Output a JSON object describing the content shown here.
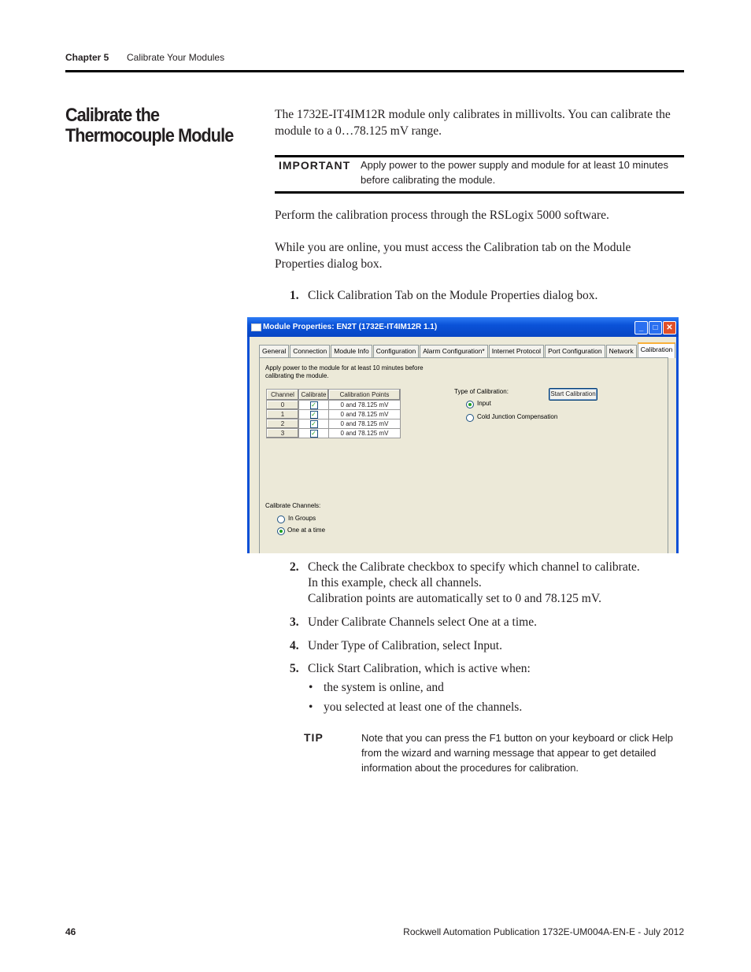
{
  "header": {
    "chapter": "Chapter 5",
    "title": "Calibrate Your Modules"
  },
  "section_title": "Calibrate the Thermocouple Module",
  "intro": "The 1732E-IT4IM12R module only calibrates in millivolts. You can calibrate the module to a 0…78.125 mV range.",
  "important": {
    "label": "IMPORTANT",
    "text": "Apply power to the power supply and module for at least 10 minutes before calibrating the module."
  },
  "para1": "Perform the calibration process through the RSLogix 5000 software.",
  "para2": "While you are online, you must access the Calibration tab on the Module Properties dialog box.",
  "steps": [
    {
      "num": "1.",
      "text": "Click Calibration Tab on the Module Properties dialog box."
    },
    {
      "num": "2.",
      "text": "Check the Calibrate checkbox to specify which channel to calibrate.",
      "extra1": "In this example, check all channels.",
      "extra2": "Calibration points are automatically set to 0 and 78.125 mV."
    },
    {
      "num": "3.",
      "text": "Under Calibrate Channels select One at a time."
    },
    {
      "num": "4.",
      "text": "Under Type of Calibration, select Input."
    },
    {
      "num": "5.",
      "text": "Click Start Calibration, which is active when:"
    }
  ],
  "bullets": [
    "the system is online, and",
    "you selected at least one of the channels."
  ],
  "tip": {
    "label": "TIP",
    "text": "Note that you can press the F1 button on your keyboard or click Help from the wizard and warning message that appear to get detailed information about the procedures for calibration."
  },
  "dialog": {
    "title": "Module Properties: EN2T (1732E-IT4IM12R 1.1)",
    "tabs": [
      "General",
      "Connection",
      "Module Info",
      "Configuration",
      "Alarm Configuration*",
      "Internet Protocol",
      "Port Configuration",
      "Network",
      "Calibration"
    ],
    "active_tab": "Calibration",
    "notice": "Apply power to the module for at least 10 minutes before calibrating the module.",
    "table": {
      "headers": [
        "Channel",
        "Calibrate",
        "Calibration Points"
      ],
      "rows": [
        {
          "channel": "0",
          "checked": true,
          "points": "0 and 78.125 mV"
        },
        {
          "channel": "1",
          "checked": true,
          "points": "0 and 78.125 mV"
        },
        {
          "channel": "2",
          "checked": true,
          "points": "0 and 78.125 mV"
        },
        {
          "channel": "3",
          "checked": true,
          "points": "0 and 78.125 mV"
        }
      ]
    },
    "type_label": "Type of Calibration:",
    "type_options": [
      "Input",
      "Cold Junction Compensation"
    ],
    "type_selected": "Input",
    "start_button": "Start Calibration",
    "channels_label": "Calibrate Channels:",
    "channel_options": [
      "In Groups",
      "One at a time"
    ],
    "channel_selected": "One at a time"
  },
  "footer": {
    "page": "46",
    "publication": "Rockwell Automation Publication 1732E-UM004A-EN-E - July 2012"
  }
}
